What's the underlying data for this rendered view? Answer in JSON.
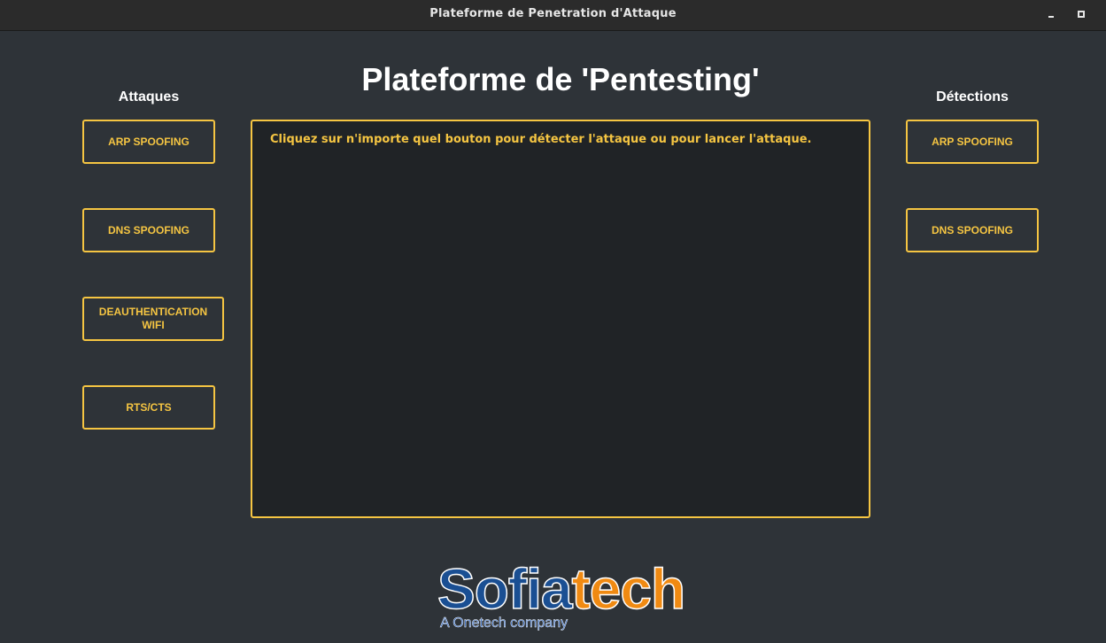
{
  "window": {
    "title": "Plateforme de Penetration d'Attaque",
    "controls": [
      "minimize-icon",
      "maximize-icon"
    ]
  },
  "header": {
    "title": "Plateforme de 'Pentesting'"
  },
  "attacks": {
    "heading": "Attaques",
    "buttons": [
      "ARP SPOOFING",
      "DNS SPOOFING",
      "DEAUTHENTICATION WIFI",
      "RTS/CTS"
    ]
  },
  "detections": {
    "heading": "Détections",
    "buttons": [
      "ARP SPOOFING",
      "DNS SPOOFING"
    ]
  },
  "output": {
    "message": "Cliquez sur n'importe quel bouton pour détecter l'attaque ou pour lancer l'attaque."
  },
  "logo": {
    "brand_part1": "Sofia",
    "brand_part2": "tech",
    "tagline": "A Onetech company"
  },
  "colors": {
    "accent": "#f5c542",
    "background": "#2e3338",
    "panel": "#202326",
    "brand_blue": "#1a4f93",
    "brand_orange": "#f08a12"
  }
}
